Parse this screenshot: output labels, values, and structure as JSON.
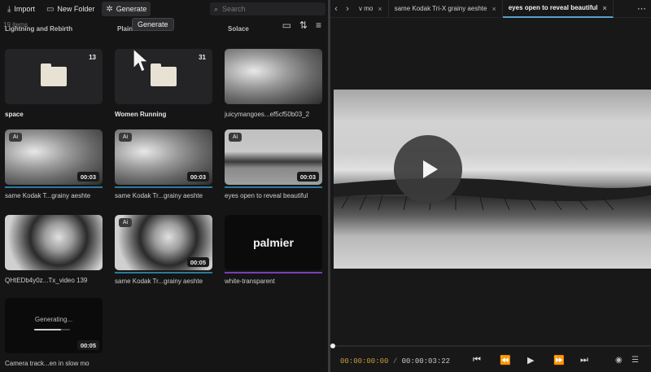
{
  "toolbar": {
    "import_label": "Import",
    "new_folder_label": "New Folder",
    "generate_label": "Generate",
    "search_placeholder": "Search",
    "tooltip": "Generate"
  },
  "library": {
    "item_count": "19 items",
    "row0": [
      "Lightning and Rebirth",
      "Plain",
      "Solace"
    ],
    "cards": [
      {
        "label": "space",
        "type": "folder",
        "count": "13"
      },
      {
        "label": "Women Running",
        "type": "folder",
        "count": "31"
      },
      {
        "label": "juicymangoes...ef5cf50b03_2",
        "type": "image"
      },
      {
        "label": "same Kodak T...grainy aeshte",
        "type": "video",
        "ai": "Ai",
        "duration": "00:03"
      },
      {
        "label": "same Kodak Tr...grainy aeshte",
        "type": "video",
        "ai": "Ai",
        "duration": "00:03"
      },
      {
        "label": "eyes open to reveal beautiful",
        "type": "video",
        "ai": "Ai",
        "duration": "00:03"
      },
      {
        "label": "QHtEDb4y0z...Tx_video 139",
        "type": "video"
      },
      {
        "label": "same Kodak Tr...grainy aeshte",
        "type": "video",
        "ai": "Ai",
        "duration": "00:05"
      },
      {
        "label": "white-transparent",
        "type": "logo",
        "text": "palmier"
      },
      {
        "label": "Camera track...en in slow mo",
        "type": "generating",
        "status": "Generating...",
        "progress": 0.75,
        "duration": "00:05"
      }
    ]
  },
  "tabs": [
    {
      "label": "v mo"
    },
    {
      "label": "same Kodak Tri-X grainy aeshte"
    },
    {
      "label": "eyes open to reveal beautiful",
      "active": true
    }
  ],
  "player": {
    "current_time": "00:00:00:00",
    "separator": "/",
    "total_time": "00:00:03:22"
  },
  "colors": {
    "timecode": "#c89a3c",
    "selected_underline": "#2c7a9c",
    "logo_underline": "#7d3cb8"
  }
}
